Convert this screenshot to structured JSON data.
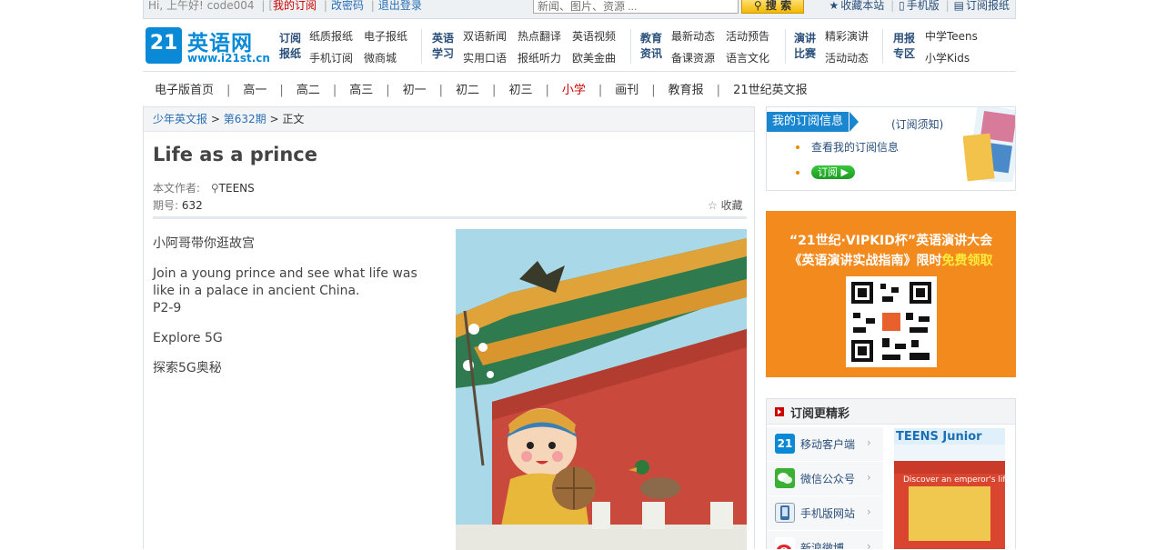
{
  "topbar": {
    "greeting": "Hi, 上午好!",
    "username": "code004",
    "my_subscription": "我的订阅",
    "change_password": "改密码",
    "logout": "退出登录",
    "search_placeholder": "新闻、图片、资源 ...",
    "search_button": "搜 索",
    "bookmark": "收藏本站",
    "mobile": "手机版",
    "subscribe_paper": "订阅报纸"
  },
  "logo": {
    "badge": "21",
    "name": "英语网",
    "url": "www.i21st.cn"
  },
  "nav_groups": [
    {
      "title": "订阅报纸",
      "links": [
        "纸质报纸",
        "电子报纸",
        "手机订阅",
        "微商城"
      ]
    },
    {
      "title": "英语学习",
      "links": [
        "双语新闻",
        "热点翻译",
        "英语视频",
        "实用口语",
        "报纸听力",
        "欧美金曲"
      ]
    },
    {
      "title": "教育资讯",
      "links": [
        "最新动态",
        "活动预告",
        "备课资源",
        "语言文化"
      ]
    },
    {
      "title": "演讲比赛",
      "links": [
        "精彩演讲",
        "活动动态"
      ]
    },
    {
      "title": "用报专区",
      "links": [
        "中学Teens",
        "小学Kids"
      ]
    }
  ],
  "subnav": [
    "电子版首页",
    "高一",
    "高二",
    "高三",
    "初一",
    "初二",
    "初三",
    "小学",
    "画刊",
    "教育报",
    "21世纪英文报"
  ],
  "subnav_active": "小学",
  "breadcrumb": {
    "section": "少年英文报",
    "issue": "第632期",
    "current": "正文"
  },
  "article": {
    "title": "Life as a prince",
    "author_label": "本文作者:",
    "author": "TEENS",
    "issue_label": "期号:",
    "issue": "632",
    "favorite": "收藏",
    "paragraphs": [
      "小阿哥带你逛故宫",
      "Join a young prince and see what life was like in a palace in ancient China.",
      "P2-9",
      "Explore 5G",
      "探索5G奥秘"
    ]
  },
  "subscription_box": {
    "title": "我的订阅信息",
    "notice": "(订阅须知)",
    "view_link": "查看我的订阅信息",
    "subscribe_button": "订阅"
  },
  "ad": {
    "line1": "“21世纪·VIPKID杯”英语演讲大会",
    "line2_a": "《英语演讲实战指南》限时",
    "line2_b": "免费领取"
  },
  "more_box": {
    "title": "订阅更精彩",
    "items": [
      "移动客户端",
      "微信公众号",
      "手机版网站",
      "新浪微博"
    ],
    "magazine_title": "TEENS Junior",
    "magazine_caption": "Discover an emperor's life"
  }
}
